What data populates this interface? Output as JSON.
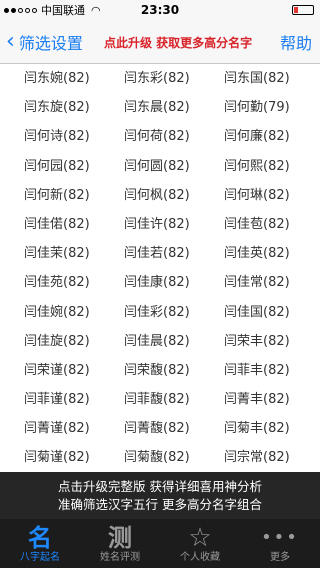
{
  "status_bar": {
    "carrier": "中国联通",
    "time": "23:30",
    "signal_strength": 2
  },
  "nav": {
    "back_label": "筛选设置",
    "upgrade_text": "点此升级 获取更多高分名字",
    "help_label": "帮助"
  },
  "names": [
    [
      "闫东婉(82)",
      "闫东彩(82)",
      "闫东国(82)"
    ],
    [
      "闫东旋(82)",
      "闫东晨(82)",
      "闫何勤(79)"
    ],
    [
      "闫何诗(82)",
      "闫何荷(82)",
      "闫何廉(82)"
    ],
    [
      "闫何园(82)",
      "闫何圆(82)",
      "闫何熙(82)"
    ],
    [
      "闫何新(82)",
      "闫何枫(82)",
      "闫何琳(82)"
    ],
    [
      "闫佳偌(82)",
      "闫佳许(82)",
      "闫佳苞(82)"
    ],
    [
      "闫佳茉(82)",
      "闫佳若(82)",
      "闫佳英(82)"
    ],
    [
      "闫佳苑(82)",
      "闫佳康(82)",
      "闫佳常(82)"
    ],
    [
      "闫佳婉(82)",
      "闫佳彩(82)",
      "闫佳国(82)"
    ],
    [
      "闫佳旋(82)",
      "闫佳晨(82)",
      "闫荣丰(82)"
    ],
    [
      "闫荣谨(82)",
      "闫荣馥(82)",
      "闫菲丰(82)"
    ],
    [
      "闫菲谨(82)",
      "闫菲馥(82)",
      "闫菁丰(82)"
    ],
    [
      "闫菁谨(82)",
      "闫菁馥(82)",
      "闫菊丰(82)"
    ],
    [
      "闫菊谨(82)",
      "闫菊馥(82)",
      "闫宗常(82)"
    ]
  ],
  "promo": {
    "line1": "点击升级完整版 获得详细喜用神分析",
    "line2": "准确筛选汉字五行 更多高分名字组合"
  },
  "tabs": [
    {
      "icon": "名",
      "label": "八字起名",
      "active": true
    },
    {
      "icon": "测",
      "label": "姓名评测",
      "active": false
    },
    {
      "icon": "☆",
      "label": "个人收藏",
      "active": false
    },
    {
      "icon": "•••",
      "label": "更多",
      "active": false
    }
  ],
  "colors": {
    "accent": "#1a7df0",
    "upgrade_red": "#d8232a",
    "tab_active": "#1e88ff"
  }
}
